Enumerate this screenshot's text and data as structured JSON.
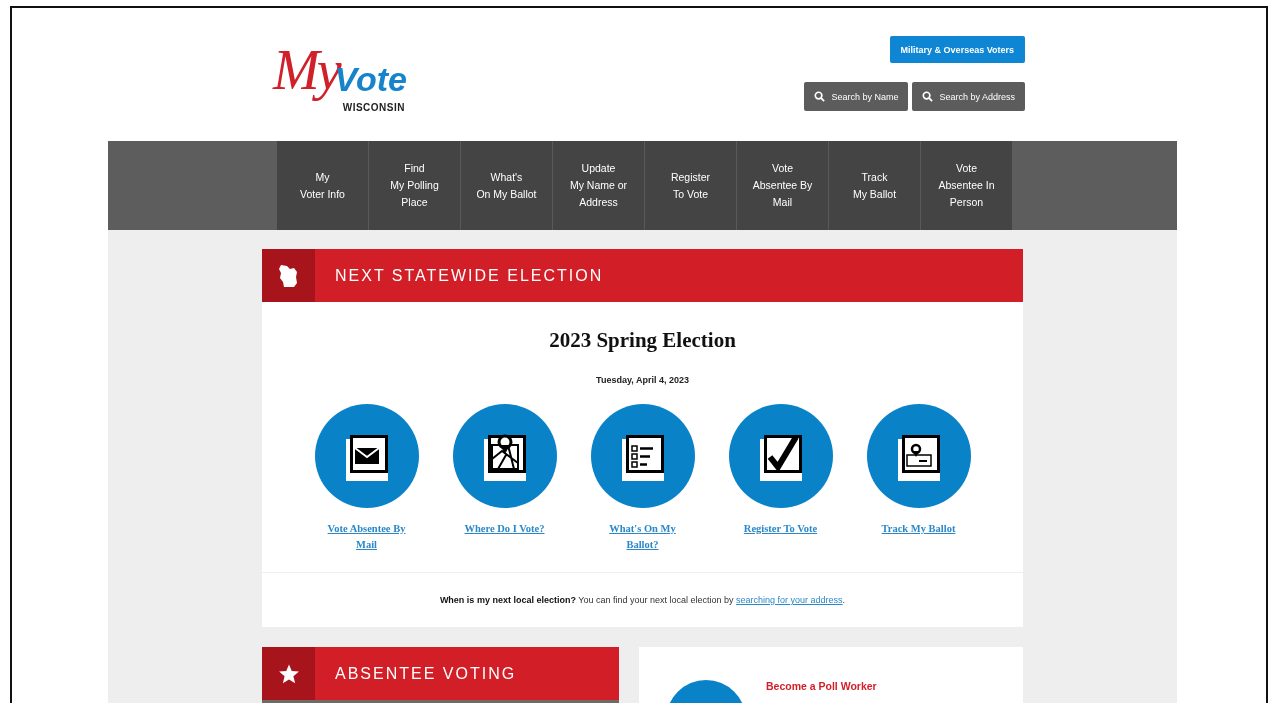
{
  "header": {
    "logo": {
      "first": "My",
      "second": "Vote",
      "subtitle": "WISCONSIN"
    },
    "top_button": "Military & Overseas Voters",
    "search_buttons": [
      "Search by Name",
      "Search by Address"
    ]
  },
  "nav": [
    {
      "label": "My\nVoter Info"
    },
    {
      "label": "Find\nMy Polling\nPlace"
    },
    {
      "label": "What's\nOn My Ballot"
    },
    {
      "label": "Update\nMy Name or\nAddress"
    },
    {
      "label": "Register\nTo Vote"
    },
    {
      "label": "Vote\nAbsentee By\nMail"
    },
    {
      "label": "Track\nMy Ballot"
    },
    {
      "label": "Vote\nAbsentee In\nPerson"
    }
  ],
  "election_card": {
    "kind": "state",
    "title": "NEXT STATEWIDE ELECTION",
    "election": "2023 Spring Election",
    "date": "Tuesday, April 4, 2023",
    "links": [
      {
        "kind": "mail",
        "label": "Vote Absentee By Mail"
      },
      {
        "kind": "map",
        "label": "Where Do I Vote?"
      },
      {
        "kind": "list",
        "label": "What's On My Ballot?"
      },
      {
        "kind": "check",
        "label": "Register To Vote"
      },
      {
        "kind": "track",
        "label": "Track My Ballot"
      }
    ],
    "note": {
      "text": "**When is my next local election?** You can find your next local election by ",
      "link": "searching for your address",
      "after": "."
    }
  },
  "absentee_card": {
    "kind": "star",
    "title": "ABSENTEE VOTING"
  },
  "poll_worker": {
    "link": "Become a Poll Worker"
  }
}
